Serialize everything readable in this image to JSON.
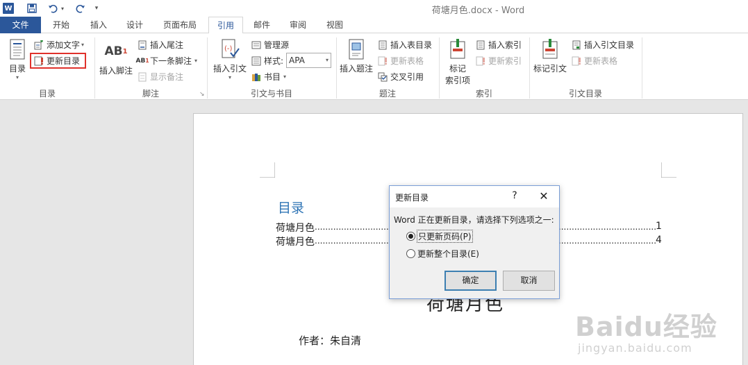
{
  "window": {
    "title": "荷塘月色.docx - Word"
  },
  "qat": {
    "app_icon": "W"
  },
  "tabs": [
    {
      "label": "文件"
    },
    {
      "label": "开始"
    },
    {
      "label": "插入"
    },
    {
      "label": "设计"
    },
    {
      "label": "页面布局"
    },
    {
      "label": "引用"
    },
    {
      "label": "邮件"
    },
    {
      "label": "审阅"
    },
    {
      "label": "视图"
    }
  ],
  "ribbon": {
    "toc": {
      "button": "目录",
      "add_text": "添加文字",
      "update_toc": "更新目录",
      "group": "目录"
    },
    "footnotes": {
      "insert_footnote": "插入脚注",
      "insert_endnote": "插入尾注",
      "next_footnote": "下一条脚注",
      "show_notes": "显示备注",
      "group": "脚注",
      "ab_label": "AB",
      "ab_sup": "1"
    },
    "citations": {
      "insert_citation": "插入引文",
      "manage_sources": "管理源",
      "style_label": "样式:",
      "style_value": "APA",
      "bibliography": "书目",
      "group": "引文与书目"
    },
    "captions": {
      "insert_caption": "插入题注",
      "insert_table_of_figures": "插入表目录",
      "update_table": "更新表格",
      "cross_reference": "交叉引用",
      "group": "题注"
    },
    "index": {
      "mark_entry_line1": "标记",
      "mark_entry_line2": "索引项",
      "insert_index": "插入索引",
      "update_index": "更新索引",
      "group": "索引"
    },
    "authorities": {
      "mark_citation": "标记引文",
      "insert_toa": "插入引文目录",
      "update_table": "更新表格",
      "group": "引文目录"
    }
  },
  "document": {
    "toc_title": "目录",
    "toc_entries": [
      {
        "text": "荷塘月色",
        "page": "1"
      },
      {
        "text": "荷塘月色",
        "page": "4"
      }
    ],
    "heading_partial": "荷塘月色",
    "author": "作者：朱自清"
  },
  "dialog": {
    "title": "更新目录",
    "help": "?",
    "close": "✕",
    "message": "Word 正在更新目录，请选择下列选项之一:",
    "option_pages": "只更新页码(P)",
    "option_entire": "更新整个目录(E)",
    "selected": "pages",
    "ok": "确定",
    "cancel": "取消"
  },
  "watermark": {
    "main": "Baidu经验",
    "sub": "jingyan.baidu.com"
  },
  "colors": {
    "accent": "#2b579a",
    "highlight_box": "#e0312b",
    "toc_title": "#2e74b5"
  }
}
